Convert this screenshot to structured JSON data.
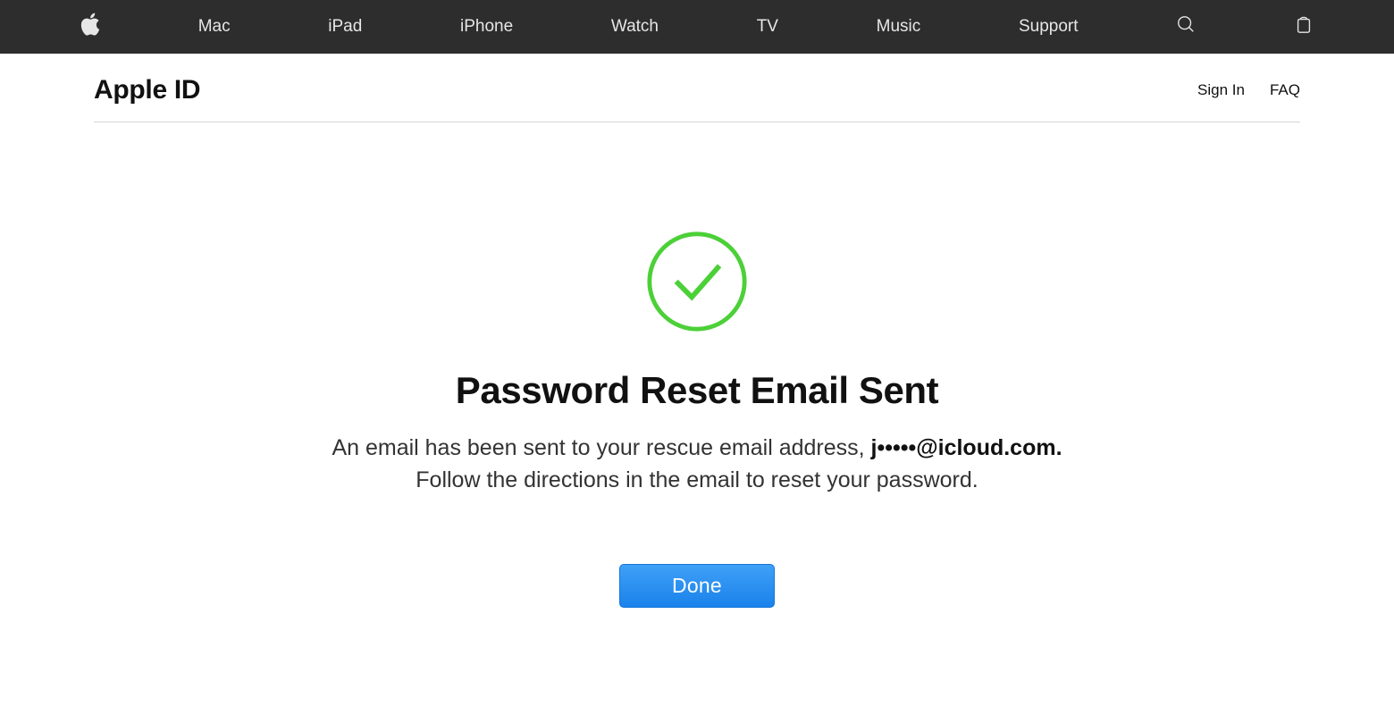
{
  "globalNav": {
    "items": [
      "Mac",
      "iPad",
      "iPhone",
      "Watch",
      "TV",
      "Music",
      "Support"
    ]
  },
  "localNav": {
    "title": "Apple ID",
    "signIn": "Sign In",
    "faq": "FAQ"
  },
  "main": {
    "heading": "Password Reset Email Sent",
    "descPrefix": "An email has been sent to your rescue email address, ",
    "email": "j•••••@icloud.com.",
    "descSuffix": " Follow the directions in the email to reset your password.",
    "doneLabel": "Done"
  },
  "colors": {
    "successGreen": "#4cd038",
    "buttonBlue": "#2a8ff0"
  }
}
